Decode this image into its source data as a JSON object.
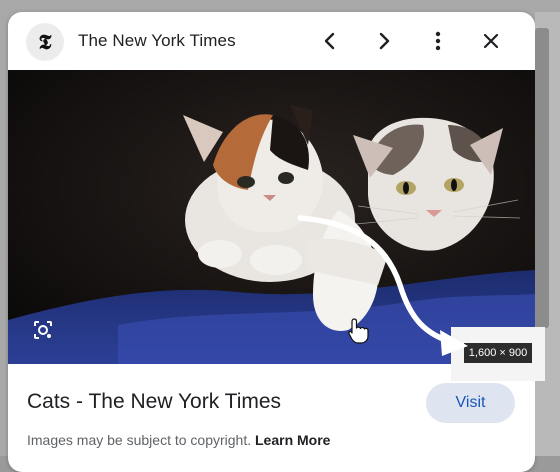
{
  "header": {
    "source_logo_text": "𝕿",
    "source_name": "The New York Times",
    "prev_icon": "chevron-left-icon",
    "next_icon": "chevron-right-icon",
    "more_icon": "more-vertical-icon",
    "close_icon": "close-icon"
  },
  "image": {
    "subject": "two kittens",
    "dimensions": "1,600 × 900",
    "lens_icon": "google-lens-icon"
  },
  "result": {
    "title": "Cats - The New York Times",
    "visit_label": "Visit",
    "copyright_text": "Images may be subject to copyright.",
    "learn_more_label": "Learn More"
  },
  "colors": {
    "visit_bg": "#dfe4f1",
    "visit_text": "#1a56b8",
    "badge_bg": "#2c2c2c"
  }
}
